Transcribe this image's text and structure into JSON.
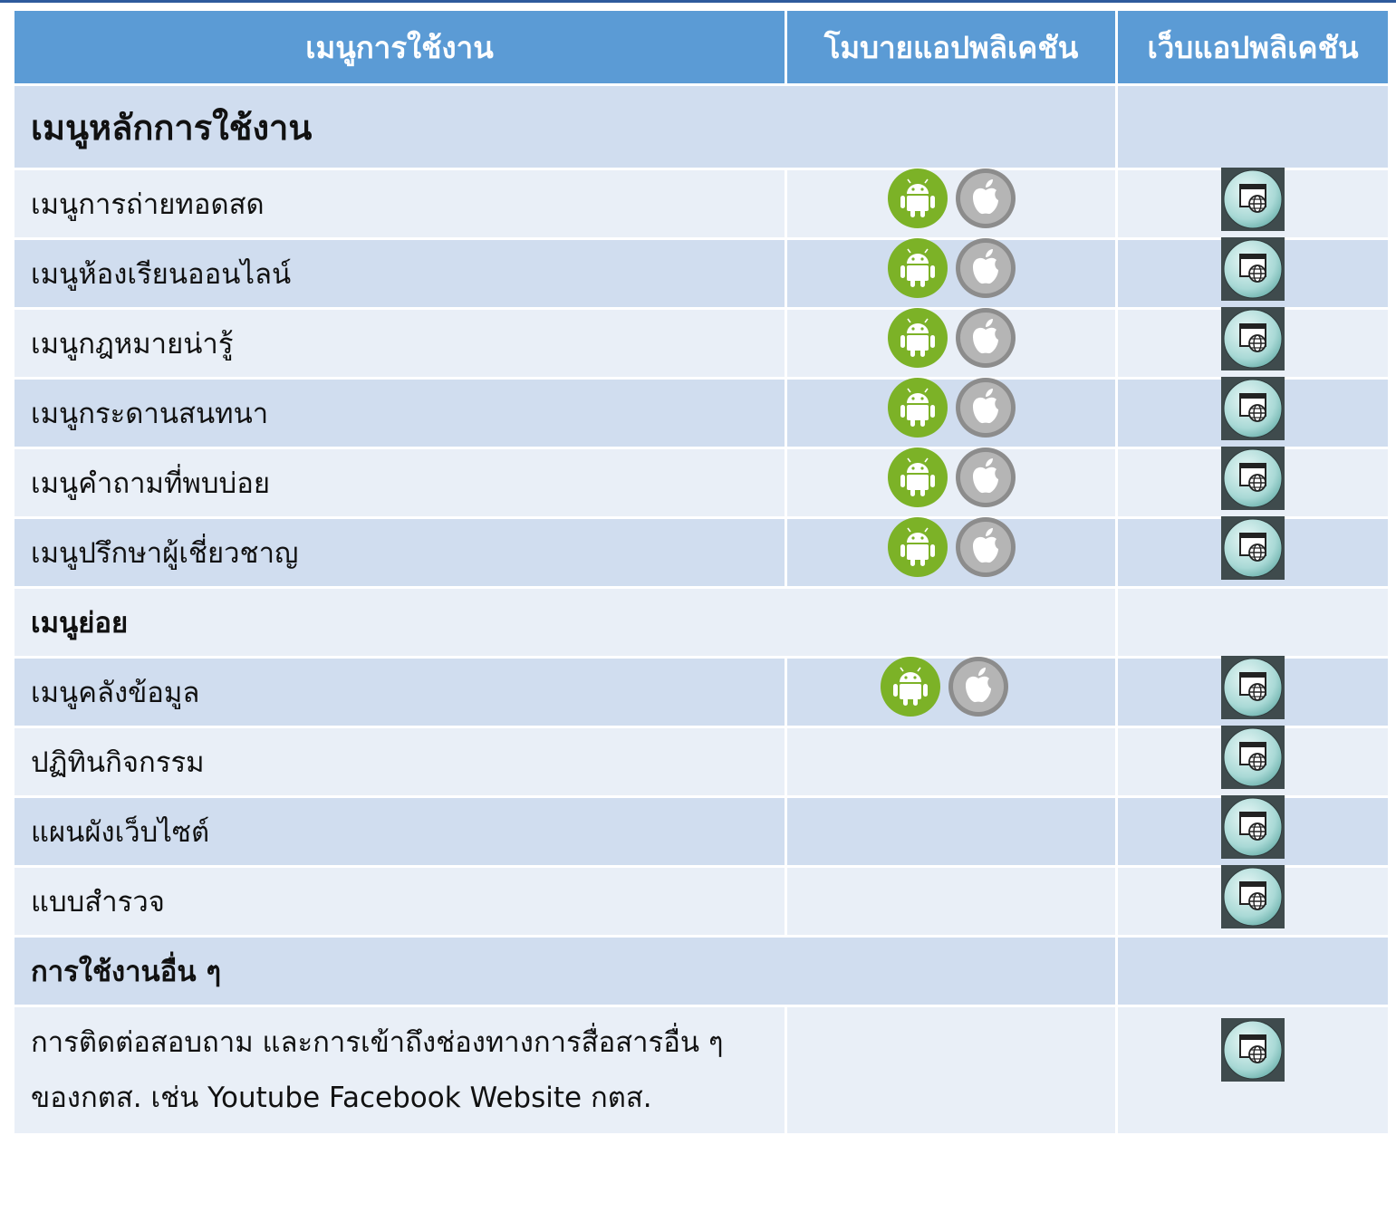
{
  "table": {
    "headers": {
      "menu": "เมนูการใช้งาน",
      "mobile": "โมบายแอปพลิเคชัน",
      "web": "เว็บแอปพลิเคชัน"
    },
    "sections": [
      {
        "title": "เมนูหลักการใช้งาน",
        "rows": [
          {
            "label": "เมนูการถ่ายทอดสด",
            "android": true,
            "ios": true,
            "web": true
          },
          {
            "label": "เมนูห้องเรียนออนไลน์",
            "android": true,
            "ios": true,
            "web": true
          },
          {
            "label": "เมนูกฎหมายน่ารู้",
            "android": true,
            "ios": true,
            "web": true
          },
          {
            "label": "เมนูกระดานสนทนา",
            "android": true,
            "ios": true,
            "web": true
          },
          {
            "label": "เมนูคำถามที่พบบ่อย",
            "android": true,
            "ios": true,
            "web": true
          },
          {
            "label": "เมนูปรึกษาผู้เชี่ยวชาญ",
            "android": true,
            "ios": true,
            "web": true
          }
        ]
      },
      {
        "title": "เมนูย่อย",
        "rows": [
          {
            "label": "เมนูคลังข้อมูล",
            "android": true,
            "ios": true,
            "web": true
          },
          {
            "label": "ปฏิทินกิจกรรม",
            "android": false,
            "ios": false,
            "web": true
          },
          {
            "label": "แผนผังเว็บไซต์",
            "android": false,
            "ios": false,
            "web": true
          },
          {
            "label": "แบบสำรวจ",
            "android": false,
            "ios": false,
            "web": true
          }
        ]
      },
      {
        "title": "การใช้งานอื่น ๆ",
        "rows": [
          {
            "label_line1": "การติดต่อสอบถาม และการเข้าถึงช่องทางการสื่อสารอื่น ๆ",
            "label_line2": "ของกตส. เช่น Youtube Facebook Website กตส.",
            "android": false,
            "ios": false,
            "web": true
          }
        ]
      }
    ]
  },
  "icons": {
    "android": "android-icon",
    "ios": "apple-icon",
    "web": "web-application-icon"
  },
  "colors": {
    "header_bg": "#5b9bd5",
    "row_dark": "#d0ddef",
    "row_light": "#e9eff7",
    "android_green": "#7cb227",
    "apple_gray": "#8c8c8c",
    "web_icon_bg": "#3f4b4d"
  }
}
